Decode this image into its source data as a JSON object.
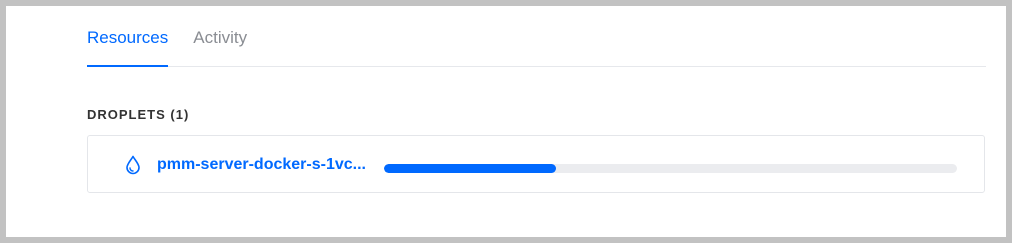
{
  "tabs": [
    {
      "label": "Resources",
      "active": true
    },
    {
      "label": "Activity",
      "active": false
    }
  ],
  "droplets_section": {
    "title": "DROPLETS (1)"
  },
  "droplet": {
    "name": "pmm-server-docker-s-1vc...",
    "icon": "droplet-icon",
    "progress": 0.3
  },
  "colors": {
    "accent": "#0069ff",
    "track": "#ebecef",
    "inactive_tab": "#8a8d93",
    "heading": "#333333"
  }
}
